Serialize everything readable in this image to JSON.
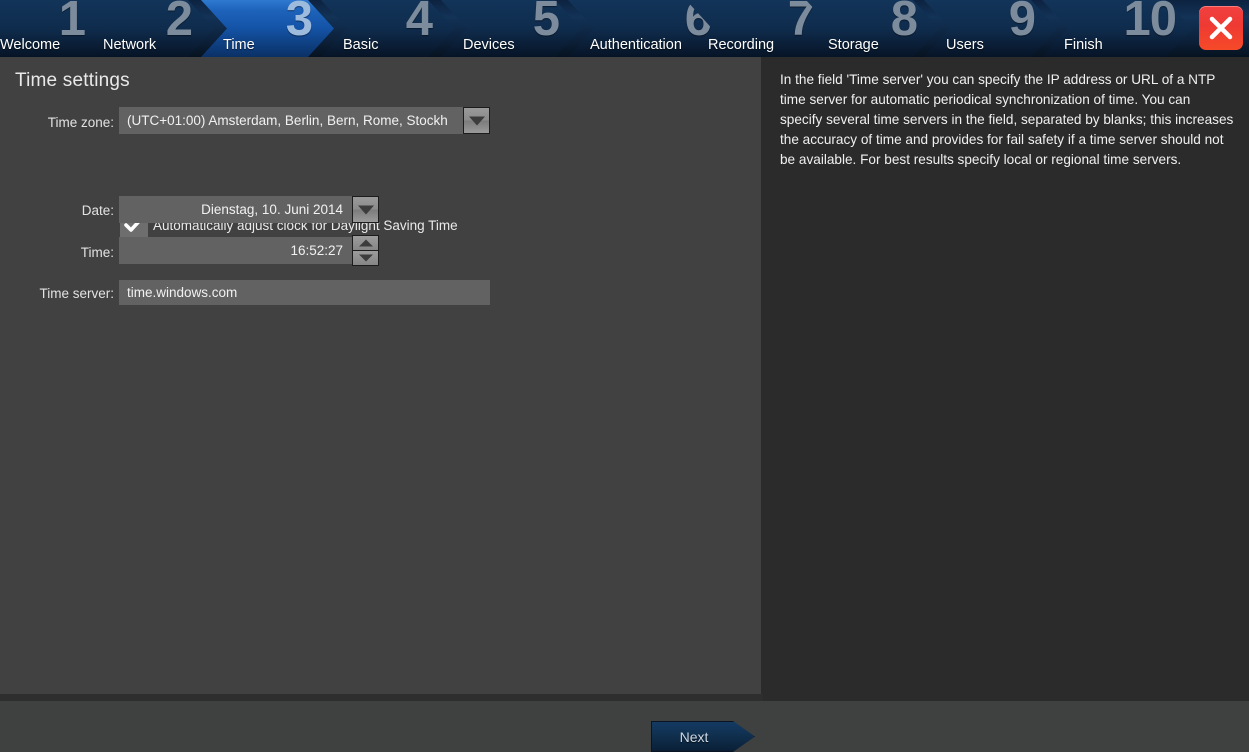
{
  "wizard": {
    "steps": [
      {
        "num": "1",
        "label": "Welcome",
        "active": false
      },
      {
        "num": "2",
        "label": "Network",
        "active": false
      },
      {
        "num": "3",
        "label": "Time",
        "active": true
      },
      {
        "num": "4",
        "label": "Basic",
        "active": false
      },
      {
        "num": "5",
        "label": "Devices",
        "active": false
      },
      {
        "num": "6",
        "label": "Authentication",
        "active": false
      },
      {
        "num": "7",
        "label": "Recording",
        "active": false
      },
      {
        "num": "8",
        "label": "Storage",
        "active": false
      },
      {
        "num": "9",
        "label": "Users",
        "active": false
      },
      {
        "num": "10",
        "label": "Finish",
        "active": false
      }
    ],
    "close_icon": "close-x-icon",
    "close_color": "#f03a33"
  },
  "page": {
    "title": "Time settings"
  },
  "form": {
    "timezone_label": "Time zone:",
    "timezone_value": "(UTC+01:00) Amsterdam, Berlin, Bern, Rome, Stockh",
    "timezone_dropdown_icon": "chevron-down-icon",
    "dst_label": "Automatically adjust clock for Daylight Saving Time",
    "dst_checked": true,
    "date_label": "Date:",
    "date_value": "Dienstag, 10. Juni 2014",
    "date_dropdown_icon": "chevron-down-icon",
    "time_label": "Time:",
    "time_value": "16:52:27",
    "time_spinner_icon": "spinner-up-down-icon",
    "timeserver_label": "Time server:",
    "timeserver_value": "time.windows.com"
  },
  "help": {
    "text": "In the field 'Time server' you can specify the IP address or URL of a NTP time server for automatic periodical synchronization of time. You can specify several time servers in the field, separated by blanks; this increases the accuracy of time and provides for fail safety if a time server should not be available. For best results specify local or regional time servers."
  },
  "footer": {
    "next_label": "Next"
  },
  "colors": {
    "panel_bg": "#414141",
    "help_bg": "#2b2b2b",
    "field_bg": "#626262",
    "accent_blue": "#1e63bb"
  }
}
